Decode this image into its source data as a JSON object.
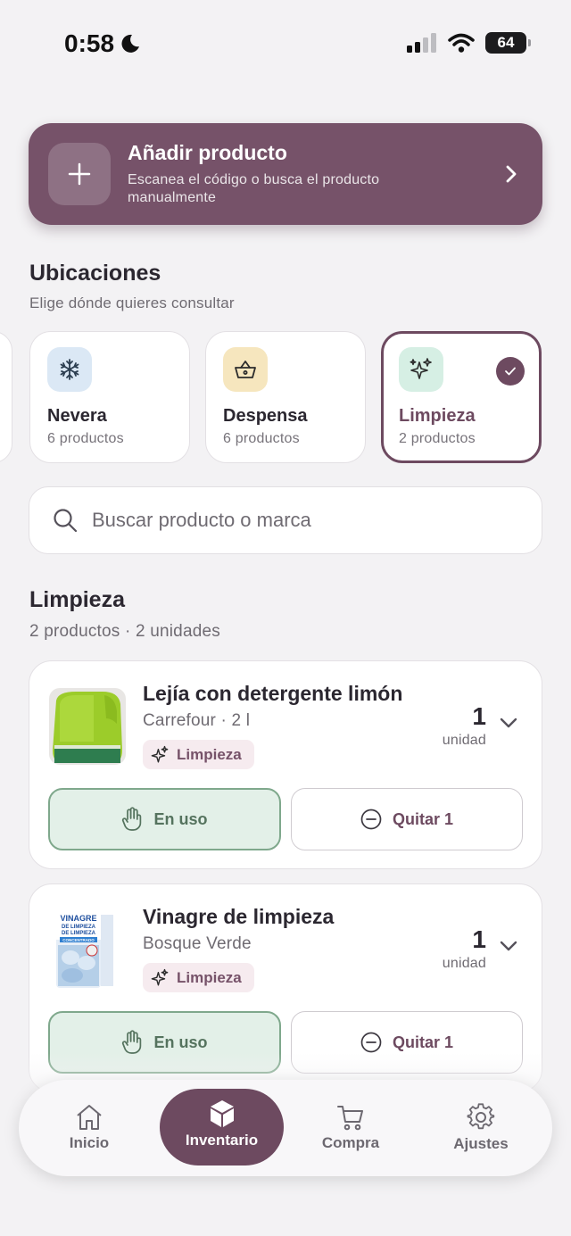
{
  "status_bar": {
    "time": "0:58",
    "battery": "64"
  },
  "add_banner": {
    "title": "Añadir producto",
    "subtitle": "Escanea el código o busca el producto manualmente"
  },
  "locations": {
    "title": "Ubicaciones",
    "subtitle": "Elige dónde quieres consultar",
    "items": [
      {
        "name": "Nevera",
        "count": "6 productos",
        "icon": "snowflake-icon",
        "selected": false
      },
      {
        "name": "Despensa",
        "count": "6 productos",
        "icon": "basket-icon",
        "selected": false
      },
      {
        "name": "Limpieza",
        "count": "2 productos",
        "icon": "sparkles-icon",
        "selected": true
      }
    ]
  },
  "search": {
    "placeholder": "Buscar producto o marca"
  },
  "list": {
    "title": "Limpieza",
    "summary": "2 productos · 2 unidades",
    "products": [
      {
        "name": "Lejía con detergente limón",
        "brand": "Carrefour · 2 l",
        "tag": "Limpieza",
        "qty": "1",
        "unit": "unidad",
        "in_use_label": "En uso",
        "remove_label": "Quitar 1"
      },
      {
        "name": "Vinagre de limpieza",
        "brand": "Bosque Verde",
        "tag": "Limpieza",
        "qty": "1",
        "unit": "unidad",
        "in_use_label": "En uso",
        "remove_label": "Quitar 1",
        "image_text": [
          "VINAGRE",
          "DE LIMPIEZA",
          "DE LIMPIEZA",
          "CONCENTRADO"
        ]
      }
    ]
  },
  "nav": {
    "items": [
      {
        "label": "Inicio",
        "icon": "home-icon"
      },
      {
        "label": "Inventario",
        "icon": "box-icon",
        "active": true
      },
      {
        "label": "Compra",
        "icon": "cart-icon"
      },
      {
        "label": "Ajustes",
        "icon": "gear-icon"
      }
    ]
  },
  "colors": {
    "primary": "#765269",
    "accent_dark": "#6d4a60",
    "in_use_bg": "#e3f0e8",
    "background": "#f3f2f4"
  }
}
